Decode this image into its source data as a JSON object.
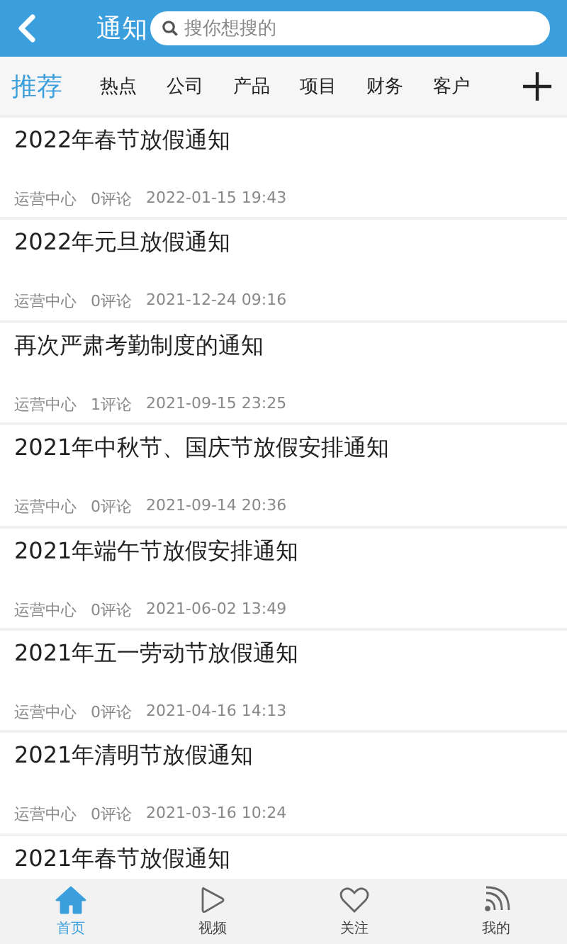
{
  "header": {
    "title": "通知",
    "search": {
      "placeholder": "搜你想搜的"
    }
  },
  "tabs": [
    {
      "label": "推荐",
      "selected": true
    },
    {
      "label": "热点",
      "selected": false
    },
    {
      "label": "公司",
      "selected": false
    },
    {
      "label": "产品",
      "selected": false
    },
    {
      "label": "项目",
      "selected": false
    },
    {
      "label": "财务",
      "selected": false
    },
    {
      "label": "客户",
      "selected": false
    }
  ],
  "articles": [
    {
      "title": "2022年春节放假通知",
      "source": "运营中心",
      "comments": "0评论",
      "time": "2022-01-15 19:43"
    },
    {
      "title": "2022年元旦放假通知",
      "source": "运营中心",
      "comments": "0评论",
      "time": "2021-12-24 09:16"
    },
    {
      "title": "再次严肃考勤制度的通知",
      "source": "运营中心",
      "comments": "1评论",
      "time": "2021-09-15 23:25"
    },
    {
      "title": "2021年中秋节、国庆节放假安排通知",
      "source": "运营中心",
      "comments": "0评论",
      "time": "2021-09-14 20:36"
    },
    {
      "title": "2021年端午节放假安排通知",
      "source": "运营中心",
      "comments": "0评论",
      "time": "2021-06-02 13:49"
    },
    {
      "title": "2021年五一劳动节放假通知",
      "source": "运营中心",
      "comments": "0评论",
      "time": "2021-04-16 14:13"
    },
    {
      "title": "2021年清明节放假通知",
      "source": "运营中心",
      "comments": "0评论",
      "time": "2021-03-16 10:24"
    },
    {
      "title": "2021年春节放假通知"
    }
  ],
  "nav": [
    {
      "kind": "home",
      "label": "首页",
      "selected": true
    },
    {
      "kind": "video",
      "label": "视频",
      "selected": false
    },
    {
      "kind": "follow",
      "label": "关注",
      "selected": false
    },
    {
      "kind": "mine",
      "label": "我的",
      "selected": false
    }
  ]
}
